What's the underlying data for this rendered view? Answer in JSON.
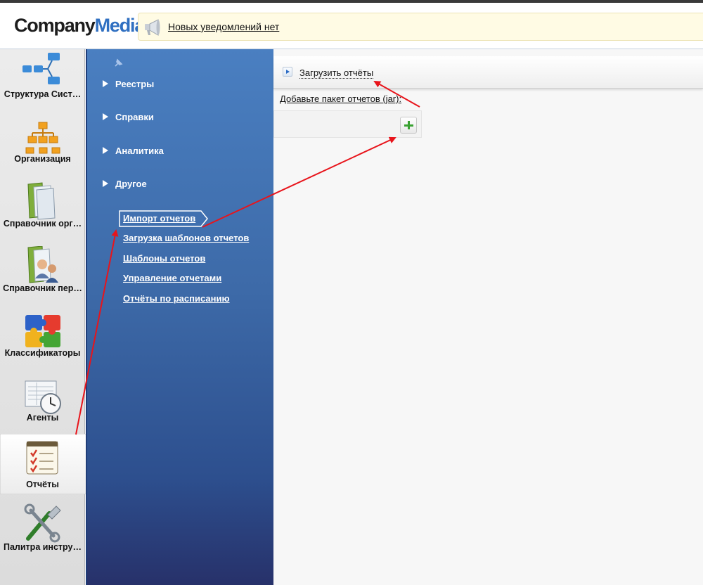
{
  "header": {
    "logo_part1": "Company",
    "logo_part2": "Media",
    "notification_text": "Новых уведомлений нет",
    "notification_icon": "megaphone-icon"
  },
  "sidebar": {
    "items": [
      {
        "label": "Структура Сист…",
        "icon": "system-structure-icon"
      },
      {
        "label": "Организация",
        "icon": "organization-icon"
      },
      {
        "label": "Справочник орг…",
        "icon": "org-directory-icon"
      },
      {
        "label": "Справочник пер…",
        "icon": "staff-directory-icon"
      },
      {
        "label": "Классификаторы",
        "icon": "puzzle-icon"
      },
      {
        "label": "Агенты",
        "icon": "agents-clock-icon"
      },
      {
        "label": "Отчёты",
        "icon": "reports-icon",
        "active": true
      },
      {
        "label": "Палитра инстру…",
        "icon": "tools-icon"
      }
    ]
  },
  "menu": {
    "sections": [
      "Реестры",
      "Справки",
      "Аналитика",
      "Другое"
    ],
    "links": [
      "Импорт отчетов",
      "Загрузка шаблонов отчетов",
      "Шаблоны отчетов",
      "Управление отчетами",
      "Отчёты по расписанию"
    ],
    "active_link": "Импорт отчетов"
  },
  "content": {
    "toolbar_action": "Загрузить отчёты",
    "field_label": "Добавьте пакет отчетов (jar):",
    "add_button": "add-icon"
  },
  "colors": {
    "accent_blue": "#2f6fc1",
    "annotation_arrow": "#e8141b",
    "add_green": "#3aa232"
  }
}
